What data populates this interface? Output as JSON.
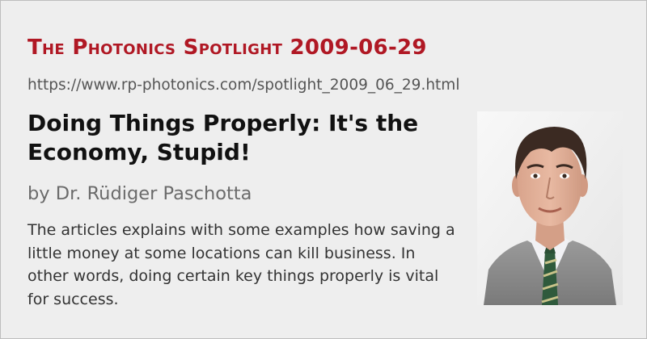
{
  "card": {
    "title": "The Photonics Spotlight 2009-06-29",
    "url": "https://www.rp-photonics.com/spotlight_2009_06_29.html",
    "headline": "Doing Things Properly: It's the Economy, Stupid!",
    "author": "by Dr. Rüdiger Paschotta",
    "summary": "The articles explains with some examples how saving a little money at some locations can kill business. In other words, doing certain key things properly is vital for success.",
    "photo_icon": "author-portrait",
    "colors": {
      "title": "#b01824",
      "background": "#eeeeee",
      "border": "#bdbdbd"
    }
  }
}
